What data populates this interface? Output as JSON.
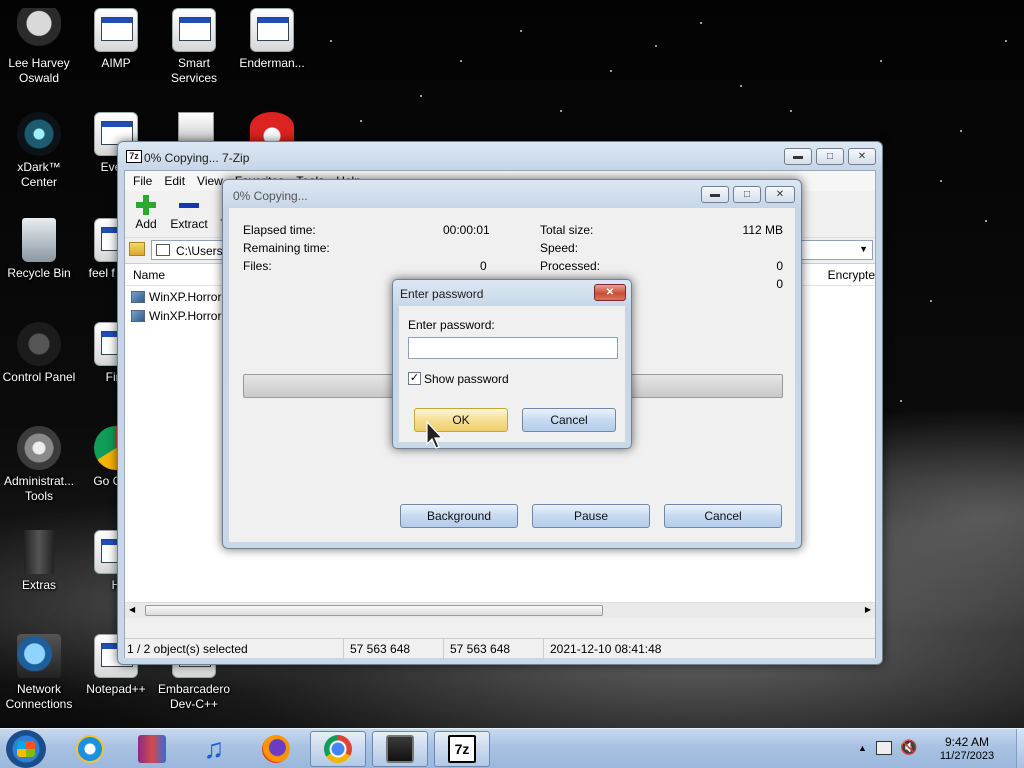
{
  "desktop": {
    "icons": [
      {
        "label": "Lee Harvey Oswald"
      },
      {
        "label": "AIMP"
      },
      {
        "label": "Smart Services"
      },
      {
        "label": "Enderman..."
      },
      {
        "label": "xDark™ Center"
      },
      {
        "label": "Every"
      },
      {
        "label": "Recycle Bin"
      },
      {
        "label": "feel f write"
      },
      {
        "label": "Control Panel"
      },
      {
        "label": "Fire"
      },
      {
        "label": "Administrat... Tools"
      },
      {
        "label": "Go Chro"
      },
      {
        "label": "Extras"
      },
      {
        "label": "H"
      },
      {
        "label": "Network Connections"
      },
      {
        "label": "Notepad++"
      },
      {
        "label": "Embarcadero Dev-C++"
      }
    ]
  },
  "zip_window": {
    "title": "0% Copying... 7-Zip",
    "app_icon": "7z",
    "menu": [
      "File",
      "Edit",
      "View",
      "Favorites",
      "Tools",
      "Help"
    ],
    "toolbar": {
      "add": "Add",
      "extract": "Extract",
      "test": "T"
    },
    "address": "C:\\Users",
    "columns": {
      "name": "Name",
      "encrypted": "Encrypte"
    },
    "files": [
      "WinXP.Horror",
      "WinXP.Horror"
    ],
    "status": {
      "selected": "1 / 2 object(s) selected",
      "size": "57 563 648",
      "packed": "57 563 648",
      "modified": "2021-12-10 08:41:48"
    }
  },
  "progress_window": {
    "title": "0% Copying...",
    "elapsed_label": "Elapsed time:",
    "elapsed_value": "00:00:01",
    "remaining_label": "Remaining time:",
    "files_label": "Files:",
    "files_value": "0",
    "total_label": "Total size:",
    "total_value": "112 MB",
    "speed_label": "Speed:",
    "processed_label": "Processed:",
    "processed_value": "0",
    "extra_value": "0",
    "background_btn": "Background",
    "pause_btn": "Pause",
    "cancel_btn": "Cancel"
  },
  "password_dialog": {
    "title": "Enter password",
    "label": "Enter password:",
    "value": "",
    "show_password": "Show password",
    "show_password_checked": true,
    "ok": "OK",
    "cancel": "Cancel"
  },
  "taskbar": {
    "time": "9:42 AM",
    "date": "11/27/2023",
    "zip_button_label": "7z"
  }
}
